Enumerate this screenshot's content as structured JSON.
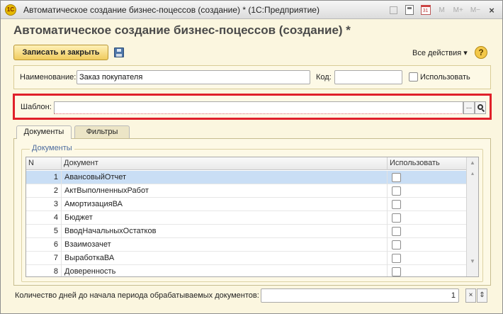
{
  "window": {
    "title": "Автоматическое создание бизнес-поцессов (создание) * (1С:Предприятие)",
    "app_icon": "1C",
    "toolbar": {
      "m": "M",
      "m_plus": "M+",
      "m_minus": "M−",
      "close": "×"
    }
  },
  "form": {
    "title": "Автоматическое создание бизнес-поцессов (создание) *",
    "save_close_label": "Записать и закрыть",
    "all_actions_label": "Все действия ▾",
    "help_label": "?"
  },
  "header": {
    "name_label": "Наименование:",
    "name_value": "Заказ покупателя",
    "code_label": "Код:",
    "code_value": "",
    "use_label": "Использовать",
    "use_checked": false
  },
  "template": {
    "label": "Шаблон:",
    "value": "",
    "select_btn": "...",
    "search_btn_icon": "search-icon"
  },
  "tabs": [
    {
      "label": "Документы",
      "active": true
    },
    {
      "label": "Фильтры",
      "active": false
    }
  ],
  "documents": {
    "group_title": "Документы",
    "columns": [
      "N",
      "Документ",
      "Использовать"
    ],
    "rows": [
      {
        "n": "1",
        "document": "АвансовыйОтчет",
        "use": false,
        "selected": true
      },
      {
        "n": "2",
        "document": "АктВыполненныхРабот",
        "use": false,
        "selected": false
      },
      {
        "n": "3",
        "document": "АмортизацияВА",
        "use": false,
        "selected": false
      },
      {
        "n": "4",
        "document": "Бюджет",
        "use": false,
        "selected": false
      },
      {
        "n": "5",
        "document": "ВводНачальныхОстатков",
        "use": false,
        "selected": false
      },
      {
        "n": "6",
        "document": "Взаимозачет",
        "use": false,
        "selected": false
      },
      {
        "n": "7",
        "document": "ВыработкаВА",
        "use": false,
        "selected": false
      },
      {
        "n": "8",
        "document": "Доверенность",
        "use": false,
        "selected": false
      }
    ]
  },
  "footer": {
    "days_label": "Количество дней до начала периода обрабатываемых документов:",
    "days_value": "1",
    "clear_btn": "×",
    "spin_btn": "⇕"
  }
}
